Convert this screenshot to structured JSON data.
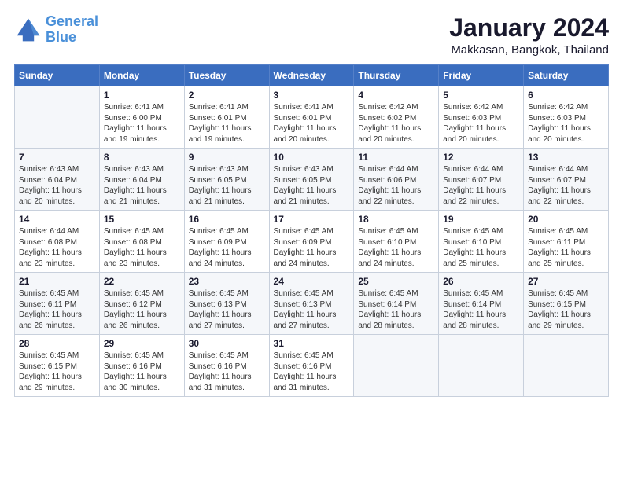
{
  "logo": {
    "line1": "General",
    "line2": "Blue"
  },
  "title": "January 2024",
  "subtitle": "Makkasan, Bangkok, Thailand",
  "header": {
    "days": [
      "Sunday",
      "Monday",
      "Tuesday",
      "Wednesday",
      "Thursday",
      "Friday",
      "Saturday"
    ]
  },
  "weeks": [
    [
      {
        "num": "",
        "info": ""
      },
      {
        "num": "1",
        "info": "Sunrise: 6:41 AM\nSunset: 6:00 PM\nDaylight: 11 hours\nand 19 minutes."
      },
      {
        "num": "2",
        "info": "Sunrise: 6:41 AM\nSunset: 6:01 PM\nDaylight: 11 hours\nand 19 minutes."
      },
      {
        "num": "3",
        "info": "Sunrise: 6:41 AM\nSunset: 6:01 PM\nDaylight: 11 hours\nand 20 minutes."
      },
      {
        "num": "4",
        "info": "Sunrise: 6:42 AM\nSunset: 6:02 PM\nDaylight: 11 hours\nand 20 minutes."
      },
      {
        "num": "5",
        "info": "Sunrise: 6:42 AM\nSunset: 6:03 PM\nDaylight: 11 hours\nand 20 minutes."
      },
      {
        "num": "6",
        "info": "Sunrise: 6:42 AM\nSunset: 6:03 PM\nDaylight: 11 hours\nand 20 minutes."
      }
    ],
    [
      {
        "num": "7",
        "info": "Sunrise: 6:43 AM\nSunset: 6:04 PM\nDaylight: 11 hours\nand 20 minutes."
      },
      {
        "num": "8",
        "info": "Sunrise: 6:43 AM\nSunset: 6:04 PM\nDaylight: 11 hours\nand 21 minutes."
      },
      {
        "num": "9",
        "info": "Sunrise: 6:43 AM\nSunset: 6:05 PM\nDaylight: 11 hours\nand 21 minutes."
      },
      {
        "num": "10",
        "info": "Sunrise: 6:43 AM\nSunset: 6:05 PM\nDaylight: 11 hours\nand 21 minutes."
      },
      {
        "num": "11",
        "info": "Sunrise: 6:44 AM\nSunset: 6:06 PM\nDaylight: 11 hours\nand 22 minutes."
      },
      {
        "num": "12",
        "info": "Sunrise: 6:44 AM\nSunset: 6:07 PM\nDaylight: 11 hours\nand 22 minutes."
      },
      {
        "num": "13",
        "info": "Sunrise: 6:44 AM\nSunset: 6:07 PM\nDaylight: 11 hours\nand 22 minutes."
      }
    ],
    [
      {
        "num": "14",
        "info": "Sunrise: 6:44 AM\nSunset: 6:08 PM\nDaylight: 11 hours\nand 23 minutes."
      },
      {
        "num": "15",
        "info": "Sunrise: 6:45 AM\nSunset: 6:08 PM\nDaylight: 11 hours\nand 23 minutes."
      },
      {
        "num": "16",
        "info": "Sunrise: 6:45 AM\nSunset: 6:09 PM\nDaylight: 11 hours\nand 24 minutes."
      },
      {
        "num": "17",
        "info": "Sunrise: 6:45 AM\nSunset: 6:09 PM\nDaylight: 11 hours\nand 24 minutes."
      },
      {
        "num": "18",
        "info": "Sunrise: 6:45 AM\nSunset: 6:10 PM\nDaylight: 11 hours\nand 24 minutes."
      },
      {
        "num": "19",
        "info": "Sunrise: 6:45 AM\nSunset: 6:10 PM\nDaylight: 11 hours\nand 25 minutes."
      },
      {
        "num": "20",
        "info": "Sunrise: 6:45 AM\nSunset: 6:11 PM\nDaylight: 11 hours\nand 25 minutes."
      }
    ],
    [
      {
        "num": "21",
        "info": "Sunrise: 6:45 AM\nSunset: 6:11 PM\nDaylight: 11 hours\nand 26 minutes."
      },
      {
        "num": "22",
        "info": "Sunrise: 6:45 AM\nSunset: 6:12 PM\nDaylight: 11 hours\nand 26 minutes."
      },
      {
        "num": "23",
        "info": "Sunrise: 6:45 AM\nSunset: 6:13 PM\nDaylight: 11 hours\nand 27 minutes."
      },
      {
        "num": "24",
        "info": "Sunrise: 6:45 AM\nSunset: 6:13 PM\nDaylight: 11 hours\nand 27 minutes."
      },
      {
        "num": "25",
        "info": "Sunrise: 6:45 AM\nSunset: 6:14 PM\nDaylight: 11 hours\nand 28 minutes."
      },
      {
        "num": "26",
        "info": "Sunrise: 6:45 AM\nSunset: 6:14 PM\nDaylight: 11 hours\nand 28 minutes."
      },
      {
        "num": "27",
        "info": "Sunrise: 6:45 AM\nSunset: 6:15 PM\nDaylight: 11 hours\nand 29 minutes."
      }
    ],
    [
      {
        "num": "28",
        "info": "Sunrise: 6:45 AM\nSunset: 6:15 PM\nDaylight: 11 hours\nand 29 minutes."
      },
      {
        "num": "29",
        "info": "Sunrise: 6:45 AM\nSunset: 6:16 PM\nDaylight: 11 hours\nand 30 minutes."
      },
      {
        "num": "30",
        "info": "Sunrise: 6:45 AM\nSunset: 6:16 PM\nDaylight: 11 hours\nand 31 minutes."
      },
      {
        "num": "31",
        "info": "Sunrise: 6:45 AM\nSunset: 6:16 PM\nDaylight: 11 hours\nand 31 minutes."
      },
      {
        "num": "",
        "info": ""
      },
      {
        "num": "",
        "info": ""
      },
      {
        "num": "",
        "info": ""
      }
    ]
  ]
}
